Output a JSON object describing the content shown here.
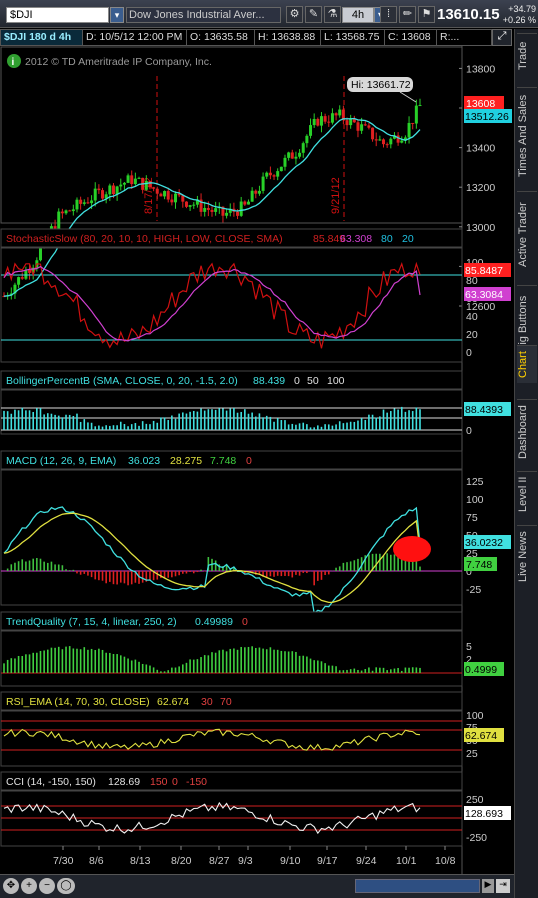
{
  "toolbar": {
    "symbol": "$DJI",
    "symbol_name": "Dow Jones Industrial Aver...",
    "aggregation": "4h",
    "last_price": "13610.15",
    "change": "+34.79",
    "change_pct": "+0.26 %"
  },
  "header": {
    "symbol_label": "$DJI 180 d 4h",
    "date": "D: 10/5/12 12:00 PM",
    "open": "O: 13635.58",
    "high": "H: 13638.88",
    "low": "L: 13568.75",
    "close": "C: 13608",
    "rest": "R:..."
  },
  "copyright": "2012 © TD Ameritrade IP Company, Inc.",
  "main_chart": {
    "hi_label": "Hi: 13661.72",
    "price_tag": "13608",
    "ma_tag": "13512.26",
    "y_ticks": [
      "14000",
      "13800",
      "13600",
      "13400",
      "13200",
      "13000",
      "12800",
      "12600"
    ],
    "date_markers": [
      "8/17/12",
      "9/21/12"
    ],
    "colors": {
      "up": "#28d028",
      "down": "#e02020",
      "ma": "#40e0e0",
      "tag_red": "#ff2020",
      "tag_cyan": "#20d0e0"
    }
  },
  "stochastic": {
    "title": "StochasticSlow (80, 20, 10, 10, HIGH, LOW, CLOSE, SMA)",
    "v1": "85.849",
    "v2": "63.308",
    "v3": "80",
    "v4": "20",
    "tag1": "85.8487",
    "tag2": "63.3084",
    "y_ticks": [
      "100",
      "80",
      "60",
      "40",
      "20",
      "0"
    ]
  },
  "bollinger": {
    "title": "BollingerPercentB (SMA, CLOSE, 0, 20, -1.5, 2.0)",
    "v1": "88.439",
    "v2": "0",
    "v3": "50",
    "v4": "100",
    "tag": "88.4393",
    "y_ticks": [
      "50",
      "0"
    ]
  },
  "macd": {
    "title": "MACD (12, 26, 9, EMA)",
    "v1": "36.023",
    "v2": "28.275",
    "v3": "7.748",
    "v4": "0",
    "tag1": "36.0232",
    "tag2": "7.748",
    "y_ticks": [
      "125",
      "100",
      "75",
      "50",
      "25",
      "0",
      "-25"
    ]
  },
  "trendquality": {
    "title": "TrendQuality (7, 15, 4, linear, 250, 2)",
    "v1": "0.49989",
    "v2": "0",
    "tag": "0.4999",
    "y_ticks": [
      "5",
      "2",
      "0"
    ]
  },
  "rsi": {
    "title": "RSI_EMA (14, 70, 30, CLOSE)",
    "v1": "62.674",
    "v2": "30",
    "v3": "70",
    "tag": "62.674",
    "y_ticks": [
      "100",
      "75",
      "50",
      "25"
    ]
  },
  "cci": {
    "title": "CCI (14, -150, 150)",
    "v1": "128.69",
    "v2": "150",
    "v3": "0",
    "v4": "-150",
    "tag": "128.693",
    "y_ticks": [
      "250",
      "-250"
    ]
  },
  "x_axis": [
    "7/30",
    "8/6",
    "8/13",
    "8/20",
    "8/27",
    "9/3",
    "9/10",
    "9/17",
    "9/24",
    "10/1",
    "10/8"
  ],
  "sidebar_tabs": [
    "Trade",
    "Times And Sales",
    "Active Trader",
    "Big Buttons",
    "Chart",
    "Dashboard",
    "Level II",
    "Live News"
  ]
}
